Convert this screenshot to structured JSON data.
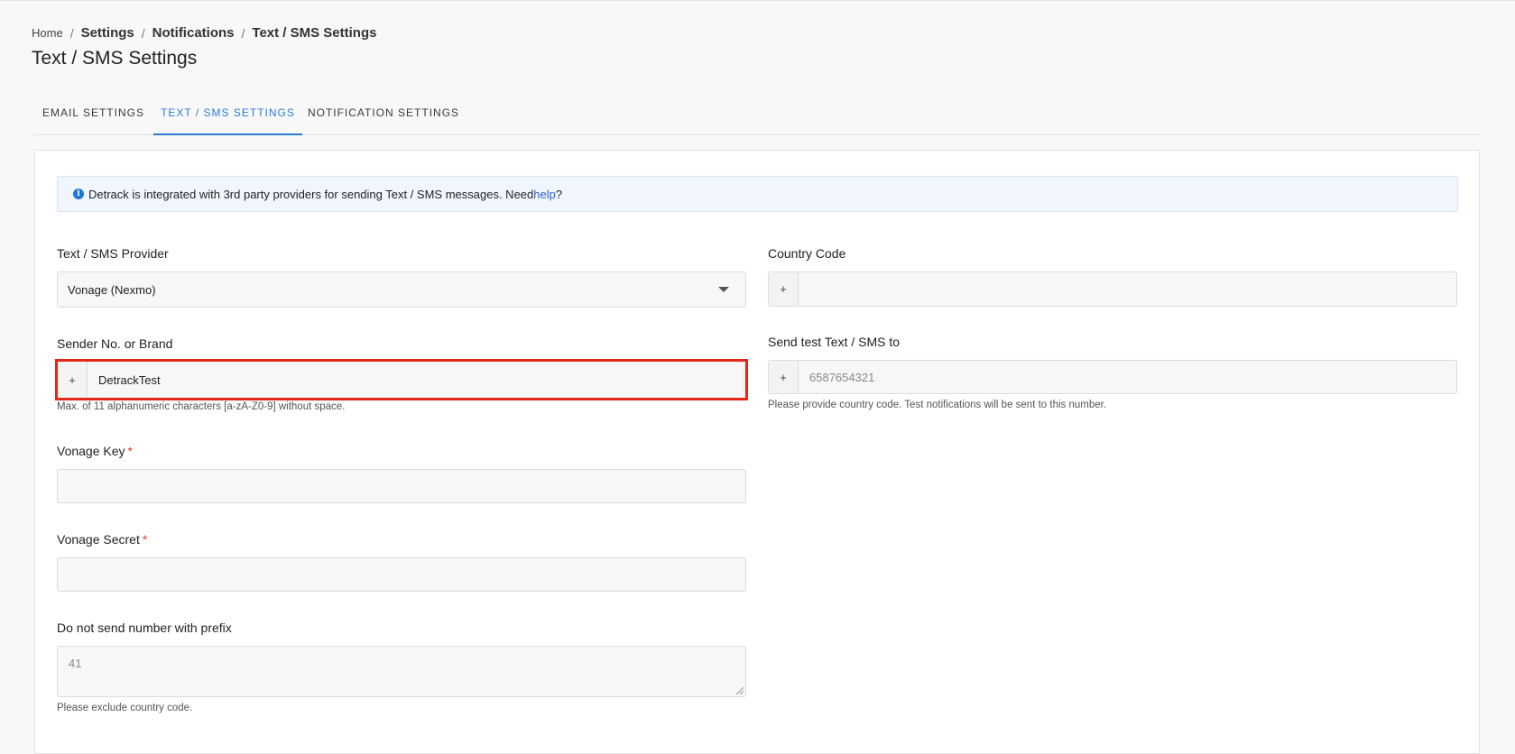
{
  "breadcrumb": {
    "home": "Home",
    "separator": "/",
    "items": [
      "Settings",
      "Notifications",
      "Text / SMS Settings"
    ]
  },
  "page_title": "Text / SMS Settings",
  "tabs": [
    {
      "label": "EMAIL SETTINGS",
      "active": false
    },
    {
      "label": "TEXT / SMS SETTINGS",
      "active": true
    },
    {
      "label": "NOTIFICATION SETTINGS",
      "active": false
    }
  ],
  "info": {
    "icon": "info-icon",
    "text": "Detrack is integrated with 3rd party providers for sending Text / SMS messages. Need ",
    "link": "help",
    "suffix": "?"
  },
  "form": {
    "provider": {
      "label": "Text / SMS Provider",
      "value": "Vonage (Nexmo)"
    },
    "sender": {
      "label": "Sender No. or Brand",
      "prefix": "+",
      "value": "DetrackTest",
      "hint": "Max. of 11 alphanumeric characters [a-zA-Z0-9] without space."
    },
    "vonage_key": {
      "label": "Vonage Key",
      "required_mark": "*",
      "value": ""
    },
    "vonage_secret": {
      "label": "Vonage Secret",
      "required_mark": "*",
      "value": ""
    },
    "no_prefix": {
      "label": "Do not send number with prefix",
      "placeholder": "41",
      "hint": "Please exclude country code."
    },
    "country_code": {
      "label": "Country Code",
      "prefix": "+",
      "value": ""
    },
    "send_test": {
      "label": "Send test Text / SMS to",
      "prefix": "+",
      "placeholder": "6587654321",
      "hint": "Please provide country code. Test notifications will be sent to this number."
    }
  },
  "colors": {
    "accent": "#2b7bd6",
    "highlight": "#e32719",
    "required": "#e53935"
  }
}
